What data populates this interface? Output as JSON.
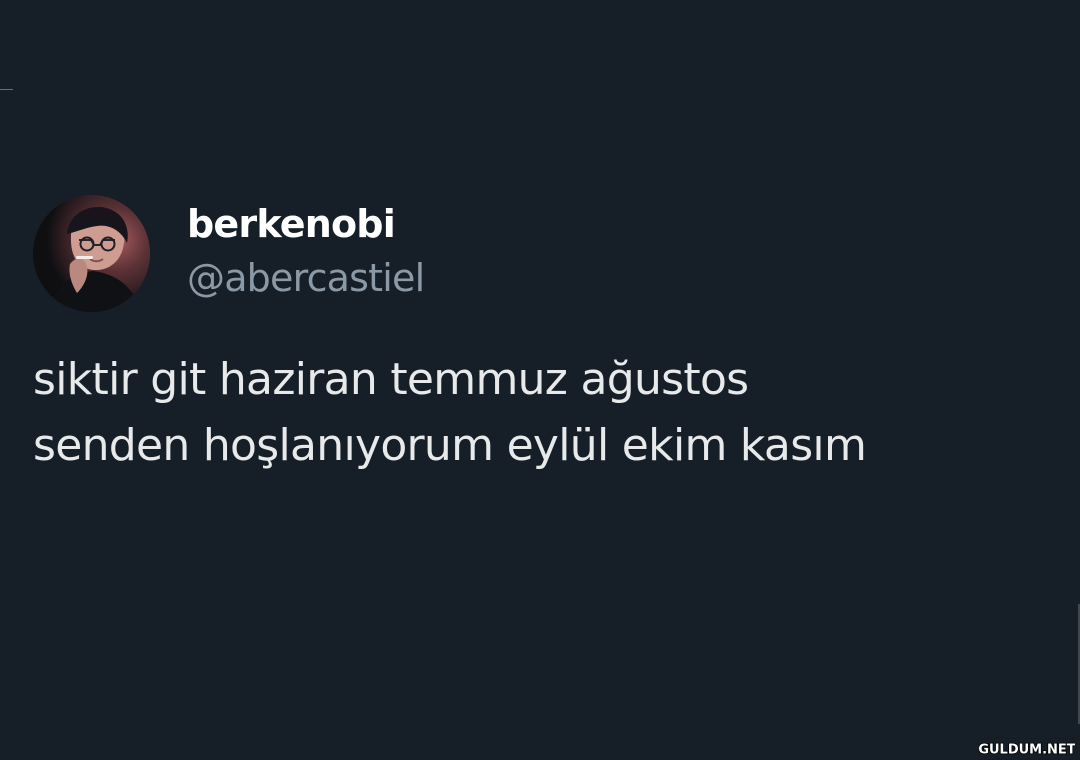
{
  "tweet": {
    "author": {
      "display_name": "berkenobi",
      "handle": "@abercastiel",
      "avatar_icon": "profile-avatar"
    },
    "text": {
      "lines": [
        "siktir git haziran temmuz ağustos",
        "senden hoşlanıyorum eylül ekim kasım"
      ]
    }
  },
  "watermark": {
    "text": "GULDUM.NET"
  },
  "colors": {
    "background": "#161f28",
    "primary_text": "#ffffff",
    "secondary_text": "#8b98a5",
    "tweet_text": "#e7e9ea"
  }
}
